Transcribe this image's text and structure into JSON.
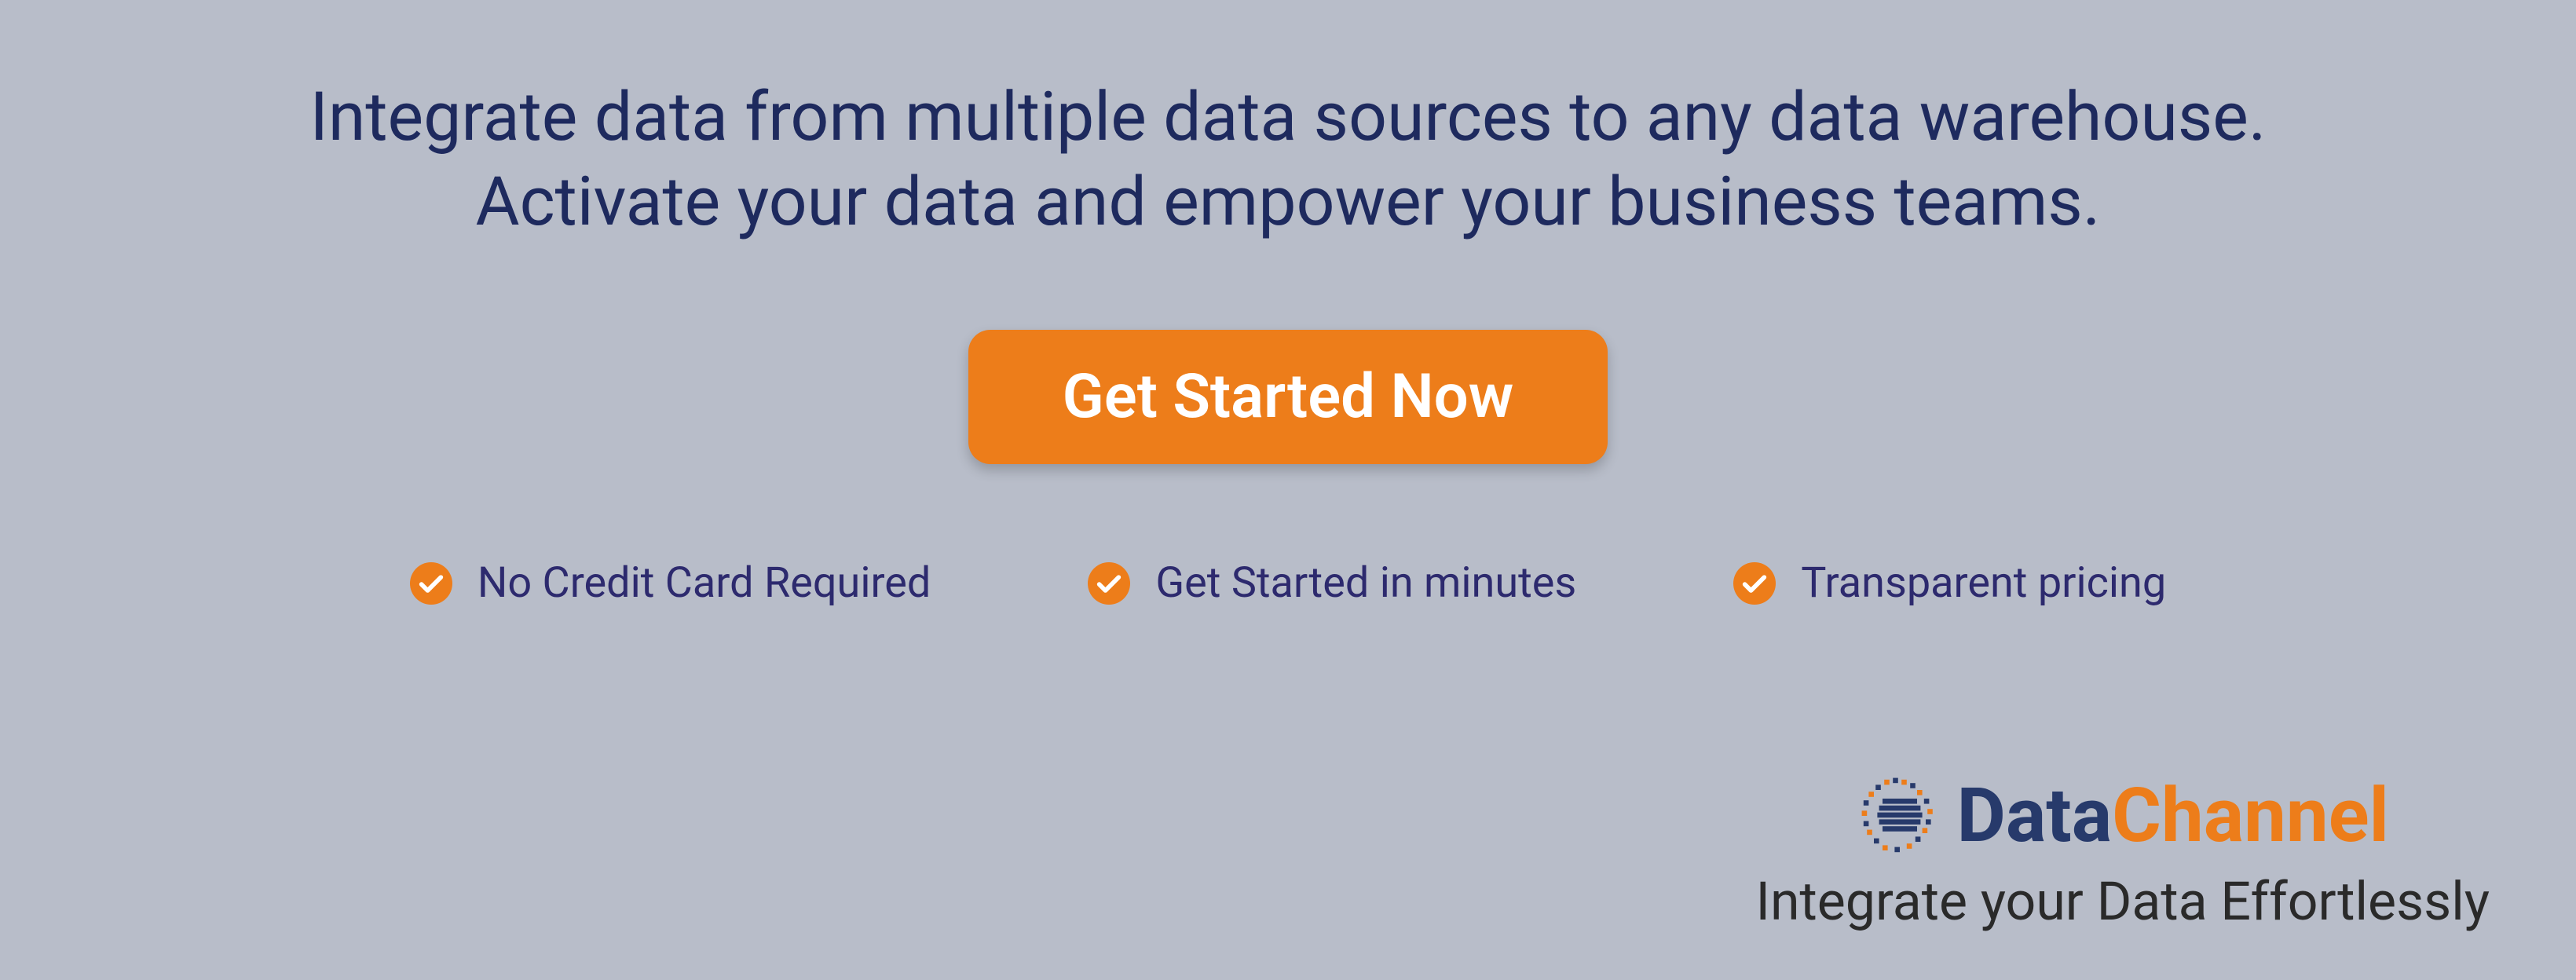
{
  "headline": {
    "line1": "Integrate data from multiple data sources to any data warehouse.",
    "line2": "Activate your data and empower your business teams."
  },
  "cta": {
    "label": "Get Started Now"
  },
  "features": [
    {
      "text": "No Credit Card Required"
    },
    {
      "text": "Get Started in minutes"
    },
    {
      "text": "Transparent pricing"
    }
  ],
  "brand": {
    "name_part1": "Data",
    "name_part2": "Channel",
    "tagline": "Integrate your Data Effortlessly"
  },
  "colors": {
    "background": "#b8bdc9",
    "headline": "#1e2a5e",
    "cta_bg": "#ed7d1a",
    "cta_text": "#ffffff",
    "feature_text": "#2d2a6e",
    "check_bg": "#ed7d1a",
    "brand_dark": "#273a6b",
    "brand_accent": "#ed7d1a",
    "tagline": "#2a2a2a"
  }
}
